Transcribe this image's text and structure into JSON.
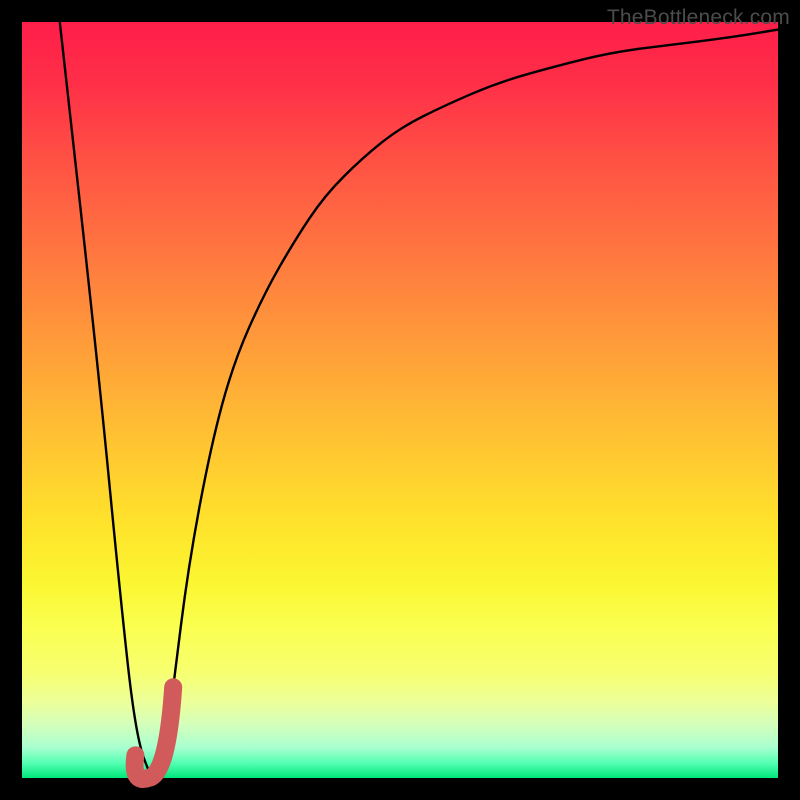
{
  "watermark": {
    "text": "TheBottleneck.com"
  },
  "colors": {
    "background_black": "#000000",
    "curve_black": "#000000",
    "marker_red": "#d15a5a"
  },
  "chart_data": {
    "type": "line",
    "title": "",
    "xlabel": "",
    "ylabel": "",
    "xlim": [
      0,
      100
    ],
    "ylim": [
      0,
      100
    ],
    "grid": false,
    "legend": false,
    "annotations": [
      {
        "text": "TheBottleneck.com",
        "position": "top-right"
      }
    ],
    "series": [
      {
        "name": "bottleneck-curve",
        "stroke": "#000000",
        "x": [
          5,
          10,
          13,
          15,
          17,
          18,
          19,
          20,
          22,
          25,
          28,
          32,
          36,
          40,
          45,
          50,
          56,
          63,
          70,
          78,
          86,
          94,
          100
        ],
        "y": [
          100,
          55,
          24,
          6,
          0,
          0,
          4,
          12,
          28,
          44,
          55,
          64,
          71,
          77,
          82,
          86,
          89,
          92,
          94,
          96,
          97,
          98,
          99
        ]
      }
    ],
    "marker": {
      "name": "selected-point-marker",
      "color": "#d15a5a",
      "shape": "J-hook",
      "approx_x_range": [
        15,
        20
      ],
      "approx_y_range": [
        0,
        12
      ]
    },
    "background_gradient": {
      "orientation": "vertical",
      "stops": [
        {
          "pos": 0.0,
          "color": "#ff1e49"
        },
        {
          "pos": 0.3,
          "color": "#ff7540"
        },
        {
          "pos": 0.66,
          "color": "#ffe22b"
        },
        {
          "pos": 0.86,
          "color": "#f7ff70"
        },
        {
          "pos": 1.0,
          "color": "#00e77a"
        }
      ]
    }
  }
}
